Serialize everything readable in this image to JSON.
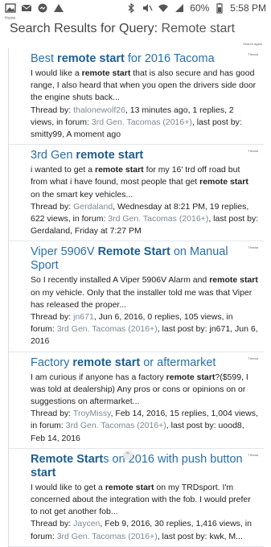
{
  "status_bar": {
    "battery": "60%",
    "time": "5:58 PM"
  },
  "breadcrumb": "Home",
  "page": {
    "title_prefix": "Search Results for Query:",
    "query": "Remote start",
    "search_again": "Search Again"
  },
  "results": [
    {
      "title_parts": [
        {
          "t": "Best ",
          "b": false
        },
        {
          "t": "remote start",
          "b": true
        },
        {
          "t": " for 2016 Tacoma",
          "b": false
        }
      ],
      "type": "Thread",
      "snippet_parts": [
        {
          "t": "I would like a ",
          "b": false
        },
        {
          "t": "remote start",
          "b": true
        },
        {
          "t": " that is also secure and has good range, I also heard that when you open the drivers side door the engine shuts back...",
          "b": false
        }
      ],
      "meta_parts": [
        {
          "t": "Thread by: ",
          "l": false
        },
        {
          "t": "thalonewolf26",
          "l": true
        },
        {
          "t": ", 13 minutes ago, 1 replies, 2 views, in forum: ",
          "l": false
        },
        {
          "t": "3rd Gen. Tacomas (2016+)",
          "l": true
        },
        {
          "t": ", last post by: smitty99, A moment ago",
          "l": false
        }
      ]
    },
    {
      "title_parts": [
        {
          "t": "3rd Gen ",
          "b": false
        },
        {
          "t": "remote start",
          "b": true
        }
      ],
      "type": "Thread",
      "snippet_parts": [
        {
          "t": "i wanted to get a ",
          "b": false
        },
        {
          "t": "remote start",
          "b": true
        },
        {
          "t": " for my 16' trd off road but from what i have found, most people that get ",
          "b": false
        },
        {
          "t": "remote start",
          "b": true
        },
        {
          "t": " on the smart key vehicles...",
          "b": false
        }
      ],
      "meta_parts": [
        {
          "t": "Thread by: ",
          "l": false
        },
        {
          "t": "Gerdaland",
          "l": true
        },
        {
          "t": ", Wednesday at 8:21 PM, 19 replies, 622 views, in forum: ",
          "l": false
        },
        {
          "t": "3rd Gen. Tacomas (2016+)",
          "l": true
        },
        {
          "t": ", last post by: Gerdaland, Friday at 7:27 PM",
          "l": false
        }
      ]
    },
    {
      "title_parts": [
        {
          "t": "Viper 5906V ",
          "b": false
        },
        {
          "t": "Remote Start",
          "b": true
        },
        {
          "t": " on Manual Sport",
          "b": false
        }
      ],
      "type": "Thread",
      "snippet_parts": [
        {
          "t": "So I recently installed A Viper 5906V Alarm and ",
          "b": false
        },
        {
          "t": "remote start",
          "b": true
        },
        {
          "t": " on my vehicle. Only that the installer told me was that Viper has released the proper...",
          "b": false
        }
      ],
      "meta_parts": [
        {
          "t": "Thread by: ",
          "l": false
        },
        {
          "t": "jn671",
          "l": true
        },
        {
          "t": ", Jun 6, 2016, 0 replies, 105 views, in forum: ",
          "l": false
        },
        {
          "t": "3rd Gen. Tacomas (2016+)",
          "l": true
        },
        {
          "t": ", last post by: jn671, Jun 6, 2016",
          "l": false
        }
      ]
    },
    {
      "title_parts": [
        {
          "t": "Factory ",
          "b": false
        },
        {
          "t": "remote start",
          "b": true
        },
        {
          "t": " or aftermarket",
          "b": false
        }
      ],
      "type": "Thread",
      "snippet_parts": [
        {
          "t": "I am curious if anyone has a factory ",
          "b": false
        },
        {
          "t": "remote start",
          "b": true
        },
        {
          "t": "?($599, I was told at dealership) Any pros or cons or opinions on or suggestions on aftermarket...",
          "b": false
        }
      ],
      "meta_parts": [
        {
          "t": "Thread by: ",
          "l": false
        },
        {
          "t": "TroyMissy",
          "l": true
        },
        {
          "t": ", Feb 14, 2016, 15 replies, 1,004 views, in forum: ",
          "l": false
        },
        {
          "t": "3rd Gen. Tacomas (2016+)",
          "l": true
        },
        {
          "t": ", last post by: uood8, Feb 14, 2016",
          "l": false
        }
      ]
    },
    {
      "title_parts": [
        {
          "t": "Remote Start",
          "b": true
        },
        {
          "t": "s on 2016 with push button ",
          "b": false
        },
        {
          "t": "start",
          "b": true
        }
      ],
      "type": "Thread",
      "snippet_parts": [
        {
          "t": "I would like to get a ",
          "b": false
        },
        {
          "t": "remote start",
          "b": true
        },
        {
          "t": " on my TRDsport. I'm concerned about the integration with the fob. I would prefer to not get another fob...",
          "b": false
        }
      ],
      "meta_parts": [
        {
          "t": "Thread by: ",
          "l": false
        },
        {
          "t": "Jaycen",
          "l": true
        },
        {
          "t": ", Feb 9, 2016, 30 replies, 1,416 views, in forum: ",
          "l": false
        },
        {
          "t": "3rd Gen. Tacomas (2016+)",
          "l": true
        },
        {
          "t": ", last post by: kwk, M...",
          "l": false
        }
      ]
    }
  ],
  "floating_button_icon": "chevron-up-icon"
}
